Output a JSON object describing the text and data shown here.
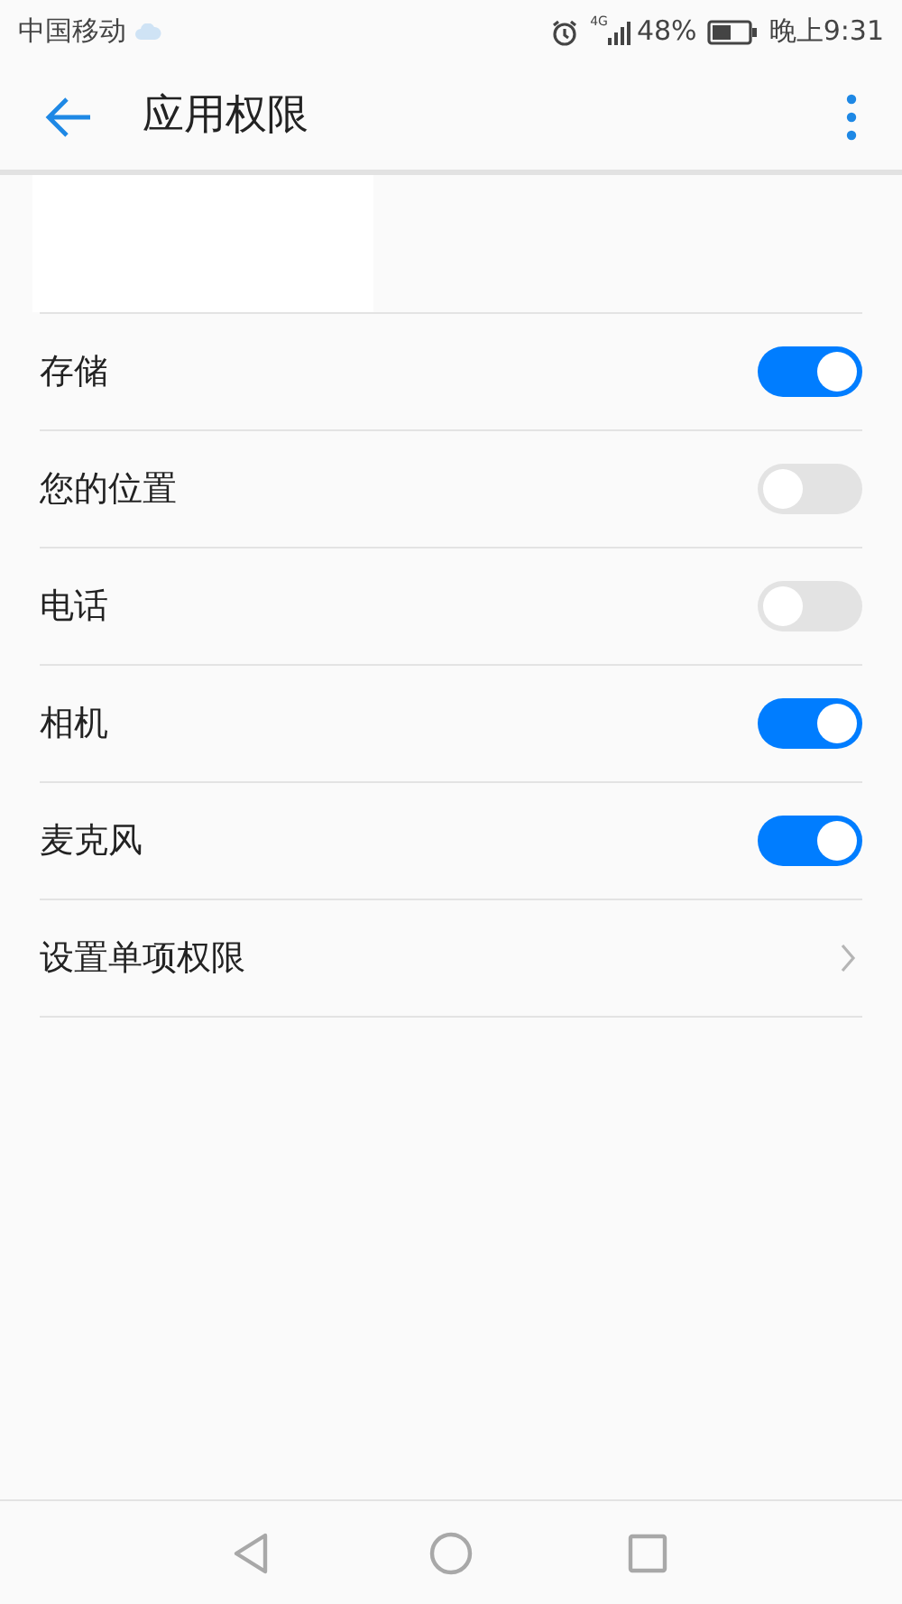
{
  "status_bar": {
    "carrier": "中国移动",
    "network": "4G",
    "battery": "48%",
    "time": "晚上9:31"
  },
  "header": {
    "title": "应用权限"
  },
  "permissions": [
    {
      "kind": "toggle",
      "label": "存储",
      "on": true
    },
    {
      "kind": "toggle",
      "label": "您的位置",
      "on": false
    },
    {
      "kind": "toggle",
      "label": "电话",
      "on": false
    },
    {
      "kind": "toggle",
      "label": "相机",
      "on": true
    },
    {
      "kind": "toggle",
      "label": "麦克风",
      "on": true
    },
    {
      "kind": "link",
      "label": "设置单项权限"
    }
  ]
}
